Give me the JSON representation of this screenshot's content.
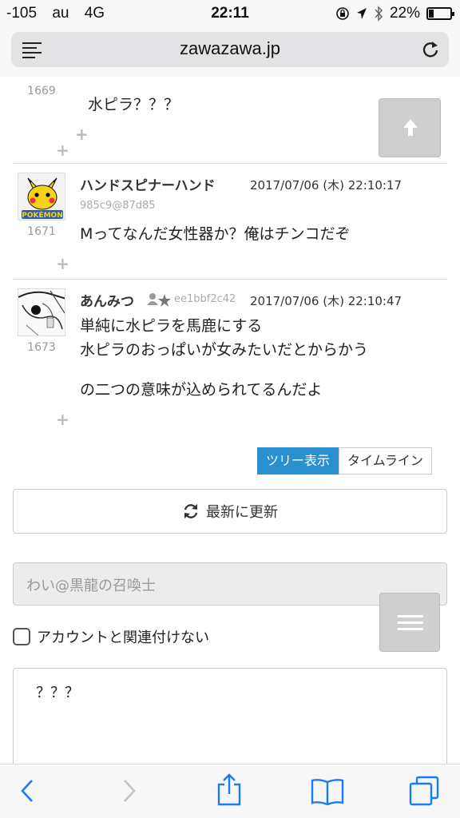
{
  "status": {
    "signal": "-105",
    "carrier": "au",
    "network": "4G",
    "time": "22:11",
    "battery_percent": "22%",
    "battery_level": 0.22
  },
  "browser": {
    "domain": "zawazawa.jp"
  },
  "posts": [
    {
      "number": "1669",
      "text": "水ピラ？？？"
    },
    {
      "number": "1671",
      "name": "ハンドスピナーハンド",
      "date": "2017/07/06 (木) 22:10:17",
      "id": "985c9@87d85",
      "text": "Mってなんだ女性器か？俺はチンコだぞ"
    },
    {
      "number": "1673",
      "name": "あんみつ",
      "id": "ee1bbf2c42",
      "date": "2017/07/06 (木) 22:10:47",
      "lines": [
        "単純に水ピラを馬鹿にする",
        "水ピラのおっぱいが女みたいだとからかう",
        "の二つの意味が込められてるんだよ"
      ]
    }
  ],
  "view_tabs": {
    "tree": "ツリー表示",
    "timeline": "タイムライン"
  },
  "refresh_label": "最新に更新",
  "form": {
    "name_placeholder": "わい@黒龍の召喚士",
    "checkbox_label": "アカウントと関連付けない",
    "comment_value": "？？？"
  },
  "colors": {
    "accent": "#2a8fce",
    "ios_blue": "#1a7cf3"
  }
}
